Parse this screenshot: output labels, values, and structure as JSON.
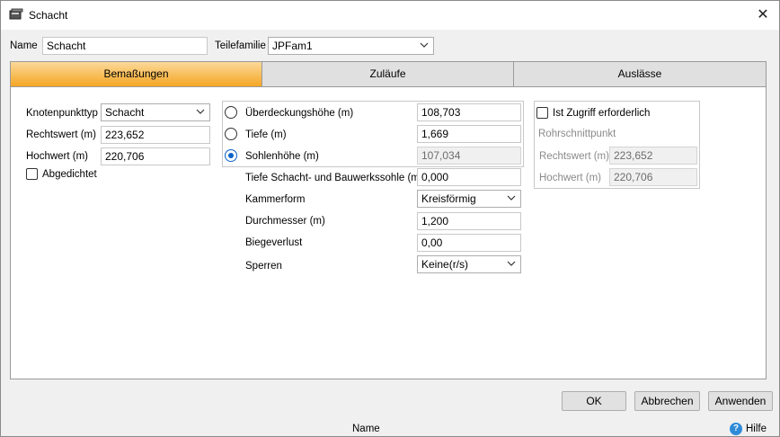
{
  "window": {
    "title": "Schacht",
    "close_label": "✕"
  },
  "header": {
    "name_label": "Name",
    "name_value": "Schacht",
    "family_label": "Teilefamilie",
    "family_value": "JPFam1"
  },
  "tabs": [
    {
      "label": "Bemaßungen",
      "active": true
    },
    {
      "label": "Zuläufe",
      "active": false
    },
    {
      "label": "Auslässe",
      "active": false
    }
  ],
  "left": {
    "node_type_label": "Knotenpunkttyp",
    "node_type_value": "Schacht",
    "easting_label": "Rechtswert (m)",
    "easting_value": "223,652",
    "northing_label": "Hochwert (m)",
    "northing_value": "220,706",
    "sealed_label": "Abgedichtet",
    "sealed_checked": false
  },
  "middle": {
    "cover_height_label": "Überdeckungshöhe (m)",
    "cover_height_value": "108,703",
    "depth_label": "Tiefe (m)",
    "depth_value": "1,669",
    "invert_label": "Sohlenhöhe (m)",
    "invert_value": "107,034",
    "selected_radio": "invert",
    "shaft_depth_label": "Tiefe Schacht- und Bauwerkssohle (m)",
    "shaft_depth_value": "0,000",
    "chamber_label": "Kammerform",
    "chamber_value": "Kreisförmig",
    "diameter_label": "Durchmesser (m)",
    "diameter_value": "1,200",
    "bend_loss_label": "Biegeverlust",
    "bend_loss_value": "0,00",
    "barriers_label": "Sperren",
    "barriers_value": "Keine(r/s)"
  },
  "right": {
    "access_label": "Ist Zugriff erforderlich",
    "access_checked": false,
    "pipe_section_label": "Rohrschnittpunkt",
    "easting_label": "Rechtswert (m)",
    "easting_value": "223,652",
    "northing_label": "Hochwert (m)",
    "northing_value": "220,706"
  },
  "buttons": {
    "ok": "OK",
    "cancel": "Abbrechen",
    "apply": "Anwenden"
  },
  "status": {
    "name": "Name",
    "help": "Hilfe"
  },
  "colors": {
    "tab_active_top": "#fbd99a",
    "tab_active_bottom": "#f5a623",
    "radio_accent": "#0a64c8",
    "help_icon": "#2e8bd8"
  },
  "icons": {
    "window": "shaft-app-icon",
    "close": "close-icon",
    "dropdown": "chevron-down-icon",
    "help": "help-icon"
  }
}
